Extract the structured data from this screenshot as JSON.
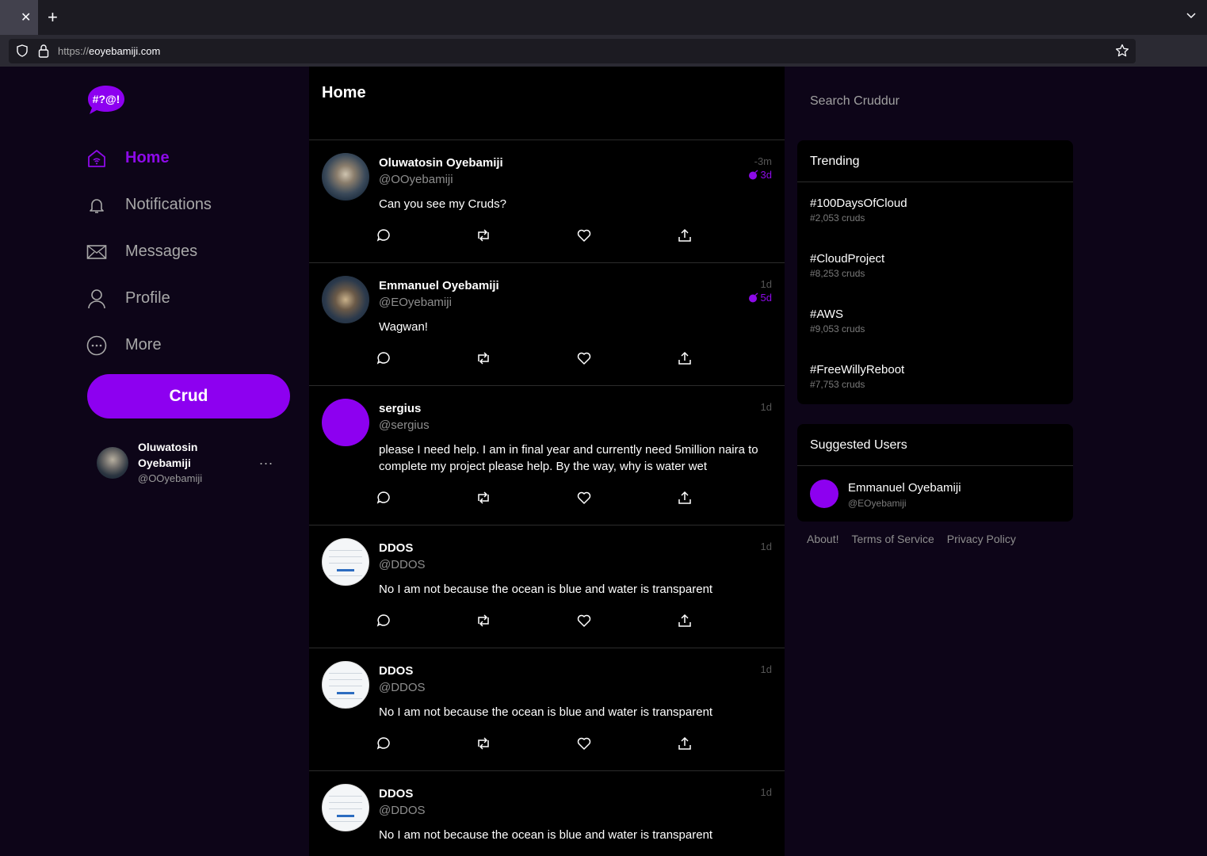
{
  "browser": {
    "url_scheme": "https://",
    "url_host": "eoyebamiji.com",
    "tab_close": "✕",
    "new_tab": "+"
  },
  "logo_text": "#?@!",
  "nav": [
    {
      "label": "Home",
      "icon": "home-icon",
      "active": true
    },
    {
      "label": "Notifications",
      "icon": "bell-icon"
    },
    {
      "label": "Messages",
      "icon": "envelope-icon"
    },
    {
      "label": "Profile",
      "icon": "user-icon"
    },
    {
      "label": "More",
      "icon": "more-circle-icon"
    }
  ],
  "crud_button": "Crud",
  "current_user": {
    "name": "Oluwatosin Oyebamiji",
    "handle": "@OOyebamiji",
    "menu": "..."
  },
  "feed": {
    "title": "Home",
    "posts": [
      {
        "name": "Oluwatosin Oyebamiji",
        "handle": "@OOyebamiji",
        "time": "-3m",
        "expires": "3d",
        "text": "Can you see my Cruds?"
      },
      {
        "name": "Emmanuel Oyebamiji",
        "handle": "@EOyebamiji",
        "time": "1d",
        "expires": "5d",
        "text": "Wagwan!"
      },
      {
        "name": "sergius",
        "handle": "@sergius",
        "time": "1d",
        "text": "please I need help. I am in final year and currently need 5million naira to complete my project please help. By the way, why is water wet"
      },
      {
        "name": "DDOS",
        "handle": "@DDOS",
        "time": "1d",
        "text": "No I am not because the ocean is blue and water is transparent"
      },
      {
        "name": "DDOS",
        "handle": "@DDOS",
        "time": "1d",
        "text": "No I am not because the ocean is blue and water is transparent"
      },
      {
        "name": "DDOS",
        "handle": "@DDOS",
        "time": "1d",
        "text": "No I am not because the ocean is blue and water is transparent"
      }
    ]
  },
  "search": {
    "placeholder": "Search Cruddur"
  },
  "trending": {
    "title": "Trending",
    "items": [
      {
        "tag": "#100DaysOfCloud",
        "count": "#2,053 cruds"
      },
      {
        "tag": "#CloudProject",
        "count": "#8,253 cruds"
      },
      {
        "tag": "#AWS",
        "count": "#9,053 cruds"
      },
      {
        "tag": "#FreeWillyReboot",
        "count": "#7,753 cruds"
      }
    ]
  },
  "suggested": {
    "title": "Suggested Users",
    "users": [
      {
        "name": "Emmanuel Oyebamiji",
        "handle": "@EOyebamiji"
      }
    ]
  },
  "footer": {
    "about": "About!",
    "terms": "Terms of Service",
    "privacy": "Privacy Policy"
  },
  "colors": {
    "accent": "#8d00f0",
    "background": "#0d0518",
    "panel": "#000000"
  }
}
